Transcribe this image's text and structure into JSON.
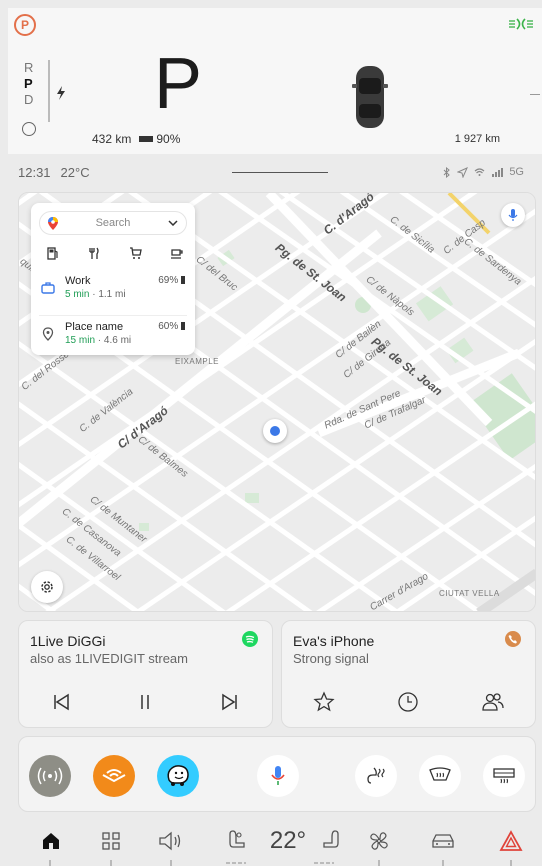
{
  "cluster": {
    "park_indicator": "P",
    "gears": [
      "R",
      "P",
      "D"
    ],
    "active_gear": "P",
    "big_gear": "P",
    "range_km": "432 km",
    "battery_percent": "90%",
    "odometer": "1 927 km"
  },
  "status": {
    "time": "12:31",
    "temperature": "22°C",
    "network": "5G"
  },
  "map": {
    "search": {
      "placeholder": "Search"
    },
    "categories": [
      "gas-station-icon",
      "restaurant-icon",
      "shopping-cart-icon",
      "coffee-icon"
    ],
    "destinations": [
      {
        "name": "Work",
        "eta": "5 min",
        "distance": " · 1.1 mi",
        "charge": "69%",
        "icon": "briefcase-icon"
      },
      {
        "name": "Place name",
        "eta": "15 min",
        "distance": " · 4.6 mi",
        "charge": "60%",
        "icon": "location-pin-icon"
      }
    ],
    "streets": {
      "st_joan_1": "Pg. de St. Joan",
      "st_joan_2": "Pg. de St. Joan",
      "arago_1": "C. d'Aragó",
      "arago_2": "C/ d'Aragó",
      "bruc": "C/ del Bruc",
      "sicilia": "C. de Sicília",
      "napols": "C/ de Nàpols",
      "casp": "C. de Casp",
      "sardenya": "C. de Sardenya",
      "bailen": "C/ de Bailèn",
      "girona": "C/ de Girona",
      "sant_pere": "Rda. de Sant Pere",
      "trafalgar": "C/ de Trafalgar",
      "valencia": "C. de València",
      "balmes": "C/ de Balmes",
      "muntaner": "C/ de Muntaner",
      "casanova": "C. de Casanova",
      "villarroel": "C. de Villarroel",
      "rosello": "C. del Rosselló",
      "carrer": "Carrer d'Arago",
      "ronda": "C.d",
      "quis": "quis"
    },
    "districts": {
      "eixample": "EIXAMPLE",
      "ciutat_vella": "CIUTAT VELLA"
    }
  },
  "radio": {
    "station": "1Live DiGGi",
    "stream": "also as 1LIVEDIGIT stream"
  },
  "phone": {
    "device": "Eva's iPhone",
    "signal": "Strong signal"
  },
  "climate": {
    "temperature": "22°"
  },
  "colors": {
    "accent_green": "#1f9d55",
    "park_orange": "#e3704a",
    "spotify_green": "#1ed760",
    "phone_orange": "#d98b4c",
    "audible_orange": "#f28a1a",
    "waze_blue": "#33ccff",
    "hazard_red": "#e0433a"
  }
}
